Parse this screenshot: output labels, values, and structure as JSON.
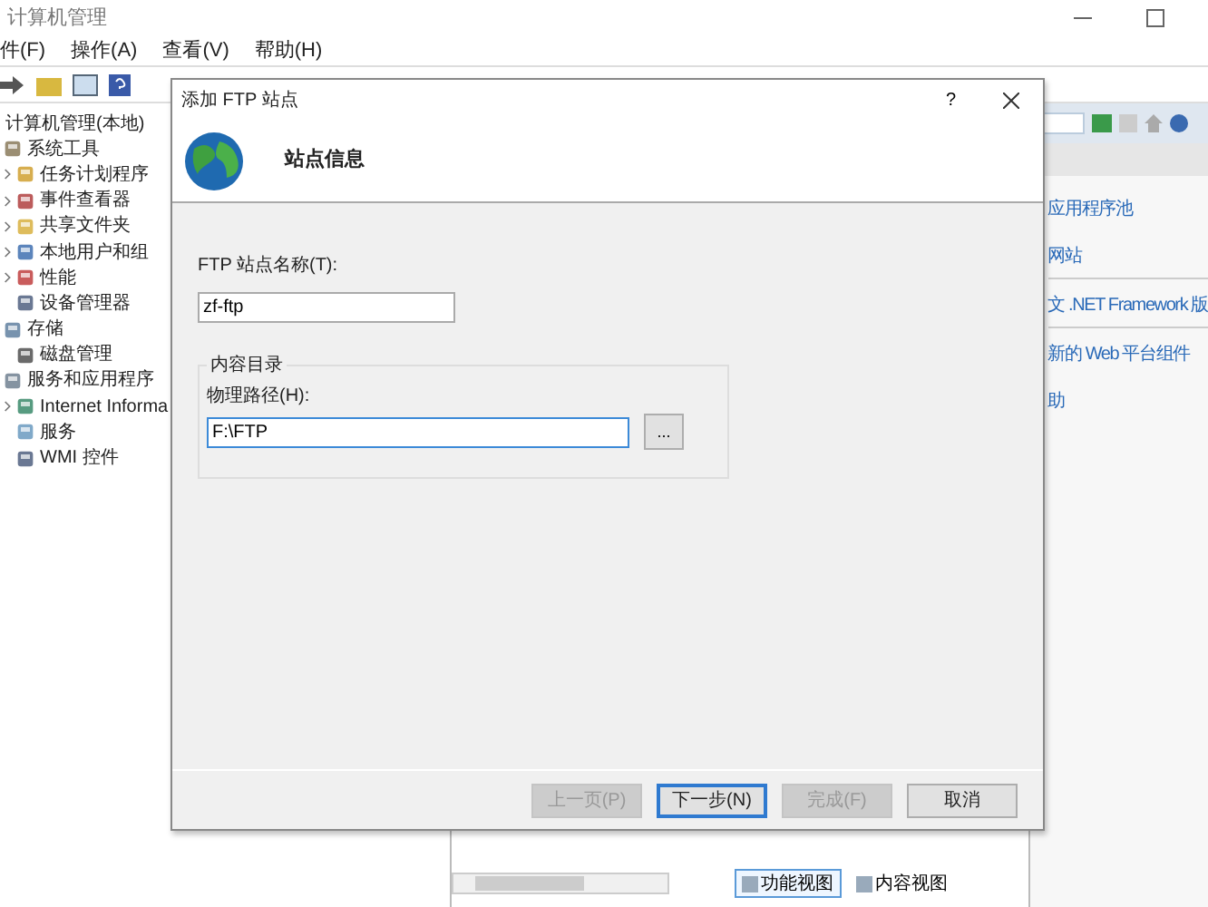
{
  "window": {
    "title": "计算机管理"
  },
  "menu": [
    {
      "label": "件(F)"
    },
    {
      "label": "操作(A)"
    },
    {
      "label": "查看(V)"
    },
    {
      "label": "帮助(H)"
    }
  ],
  "tree": [
    {
      "label": "计算机管理(本地)",
      "expandable": false,
      "children": [
        {
          "label": "系统工具",
          "expandable": false,
          "children": [
            {
              "label": "任务计划程序",
              "expandable": true
            },
            {
              "label": "事件查看器",
              "expandable": true
            },
            {
              "label": "共享文件夹",
              "expandable": true
            },
            {
              "label": "本地用户和组",
              "expandable": true
            },
            {
              "label": "性能",
              "expandable": true
            },
            {
              "label": "设备管理器",
              "expandable": false
            }
          ]
        },
        {
          "label": "存储",
          "expandable": false,
          "children": [
            {
              "label": "磁盘管理",
              "expandable": false
            }
          ]
        },
        {
          "label": "服务和应用程序",
          "expandable": false,
          "children": [
            {
              "label": "Internet Informa",
              "expandable": true
            },
            {
              "label": "服务",
              "expandable": false
            },
            {
              "label": "WMI 控件",
              "expandable": false
            }
          ]
        }
      ]
    }
  ],
  "actions": [
    {
      "label": "应用程序池"
    },
    {
      "label": "网站"
    },
    {
      "label": "文 .NET Framework 版"
    },
    {
      "label": "新的 Web 平台组件"
    },
    {
      "label": "助"
    }
  ],
  "view_tabs": [
    {
      "label": "功能视图",
      "selected": true
    },
    {
      "label": "内容视图",
      "selected": false
    }
  ],
  "dialog": {
    "title": "添加 FTP 站点",
    "help": "?",
    "heading": "站点信息",
    "site_name": {
      "label": "FTP 站点名称(T):",
      "value": "zf-ftp"
    },
    "group": {
      "title": "内容目录",
      "path_label": "物理路径(H):",
      "path_value": "F:\\FTP",
      "browse": "..."
    },
    "buttons": [
      {
        "label": "上一页(P)",
        "disabled": true,
        "focused": false
      },
      {
        "label": "下一步(N)",
        "disabled": false,
        "focused": true
      },
      {
        "label": "完成(F)",
        "disabled": true,
        "focused": false
      },
      {
        "label": "取消",
        "disabled": false,
        "focused": false
      }
    ]
  }
}
